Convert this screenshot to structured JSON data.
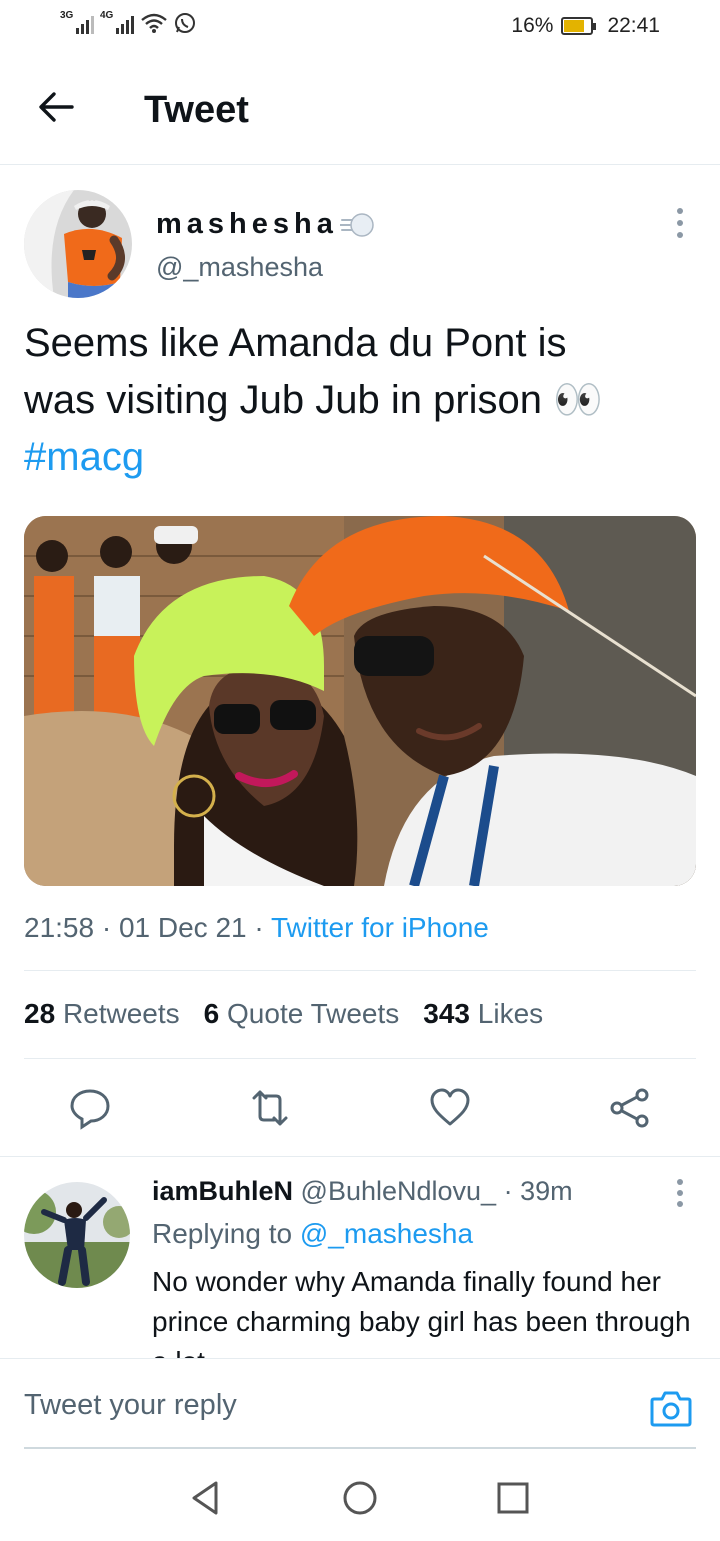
{
  "status_bar": {
    "sim1": "3G",
    "sim2": "4G",
    "battery": "16%",
    "time": "22:41"
  },
  "header": {
    "title": "Tweet"
  },
  "tweet": {
    "display_name": "mashesha",
    "handle": "@_mashesha",
    "text_line1": "Seems like Amanda du Pont is",
    "text_line2": "was visiting Jub Jub in prison 👀",
    "hashtag": "#macg",
    "time": "21:58",
    "date": "01 Dec 21",
    "source": "Twitter for iPhone",
    "retweets": "28",
    "retweets_label": "Retweets",
    "quotes": "6",
    "quotes_label": "Quote Tweets",
    "likes": "343",
    "likes_label": "Likes"
  },
  "reply": {
    "display_name": "iamBuhleN",
    "handle": "@BuhleNdlovu_",
    "age": "· 39m",
    "replying_label": "Replying to",
    "replying_to": "@_mashesha",
    "text": "No wonder why Amanda finally found her prince charming baby girl has been through a lot"
  },
  "compose": {
    "placeholder": "Tweet your reply"
  },
  "colors": {
    "accent": "#1d9bf0",
    "secondary_text": "#536471",
    "hat_orange": "#f06a1a",
    "beanie_green": "#c8f25a"
  },
  "icons": [
    "back-arrow-icon",
    "cloud-emoji-icon",
    "more-vertical-icon",
    "reply-icon",
    "retweet-icon",
    "like-icon",
    "share-icon",
    "camera-icon",
    "nav-back-icon",
    "nav-home-icon",
    "nav-recents-icon"
  ]
}
